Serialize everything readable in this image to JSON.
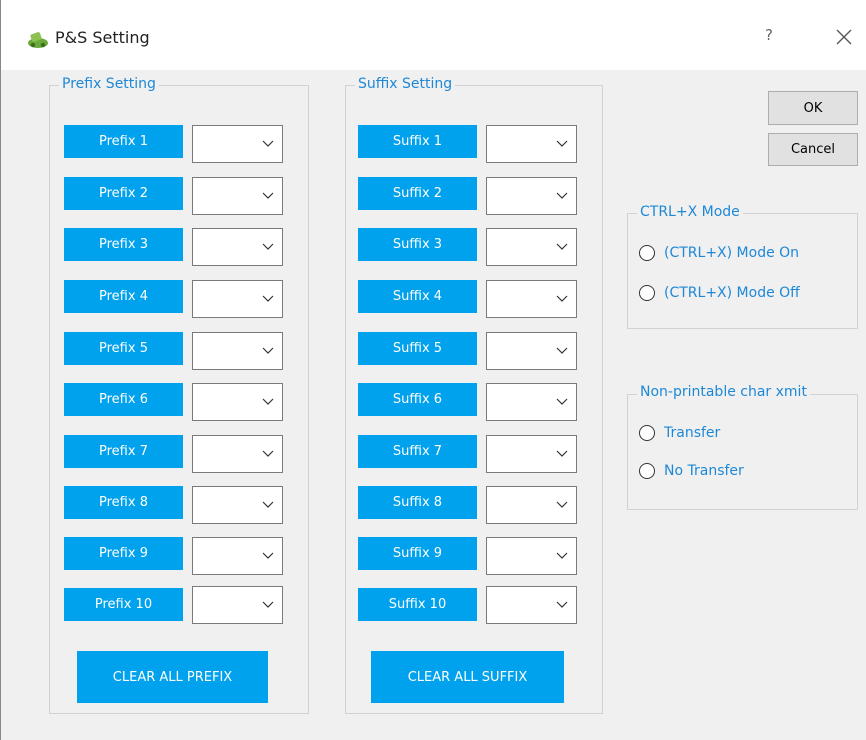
{
  "window": {
    "title": "P&S Setting",
    "help": "?"
  },
  "prefix": {
    "legend": "Prefix Setting",
    "buttons": [
      "Prefix 1",
      "Prefix 2",
      "Prefix 3",
      "Prefix 4",
      "Prefix 5",
      "Prefix 6",
      "Prefix 7",
      "Prefix 8",
      "Prefix 9",
      "Prefix 10"
    ],
    "clear_label": "CLEAR ALL PREFIX"
  },
  "suffix": {
    "legend": "Suffix Setting",
    "buttons": [
      "Suffix 1",
      "Suffix 2",
      "Suffix 3",
      "Suffix 4",
      "Suffix 5",
      "Suffix 6",
      "Suffix 7",
      "Suffix 8",
      "Suffix 9",
      "Suffix 10"
    ],
    "clear_label": "CLEAR ALL SUFFIX"
  },
  "actions": {
    "ok_label": "OK",
    "cancel_label": "Cancel"
  },
  "ctrlx": {
    "legend": "CTRL+X Mode",
    "options": [
      "(CTRL+X) Mode On",
      "(CTRL+X) Mode Off"
    ]
  },
  "nonprint": {
    "legend": "Non-printable char xmit",
    "options": [
      "Transfer",
      "No Transfer"
    ]
  },
  "colors": {
    "accent_button": "#00a2ed",
    "label_blue": "#1e88d6"
  }
}
